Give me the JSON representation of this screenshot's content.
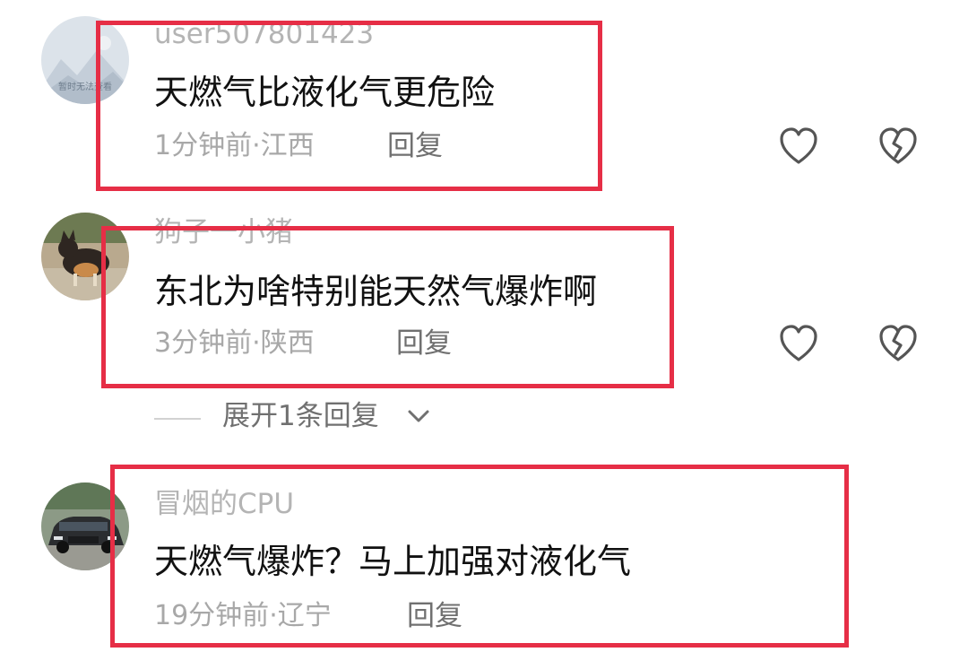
{
  "comments": [
    {
      "username": "user507801423",
      "text": "天燃气比液化气更危险",
      "time": "1分钟前",
      "separator": "·",
      "location": "江西",
      "reply_label": "回复",
      "avatar_caption": "暂时无法查看"
    },
    {
      "username": "狗子一小猪",
      "text": "东北为啥特别能天然气爆炸啊",
      "time": "3分钟前",
      "separator": "·",
      "location": "陕西",
      "reply_label": "回复",
      "expand_label": "展开1条回复"
    },
    {
      "username": "冒烟的CPU",
      "text": "天燃气爆炸？马上加强对液化气",
      "time": "19分钟前",
      "separator": "·",
      "location": "辽宁",
      "reply_label": "回复"
    }
  ],
  "icons": {
    "like": "heart-outline-icon",
    "dislike": "broken-heart-icon",
    "expand": "chevron-down-icon"
  },
  "colors": {
    "highlight_border": "#e62e46",
    "username": "#b4b4b4",
    "meta": "#a8a8a8",
    "reply": "#707070",
    "text": "#111111"
  }
}
